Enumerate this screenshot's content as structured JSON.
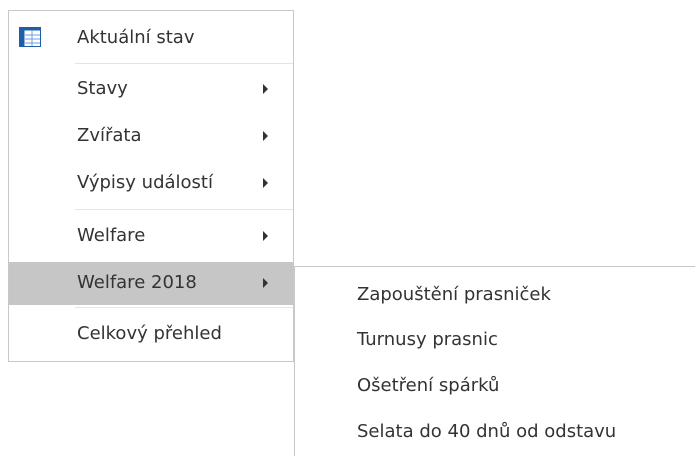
{
  "main_menu": {
    "items": [
      {
        "label": "Aktuální stav",
        "icon": "table-grid-icon"
      },
      {
        "label": "Stavy"
      },
      {
        "label": "Zvířata"
      },
      {
        "label": "Výpisy událostí"
      },
      {
        "label": "Welfare"
      },
      {
        "label": "Welfare 2018",
        "state": "highlighted"
      },
      {
        "label": "Celkový přehled"
      }
    ]
  },
  "sub_menu": {
    "items": [
      {
        "label": "Zapouštění prasniček"
      },
      {
        "label": "Turnusy prasnic"
      },
      {
        "label": "Ošetření spárků"
      },
      {
        "label": "Selata do 40 dnů od odstavu"
      }
    ]
  },
  "colors": {
    "highlight": "#c6c6c6",
    "text": "#333333",
    "border": "#c8c8c8",
    "icon_blue": "#1e5fa8"
  }
}
